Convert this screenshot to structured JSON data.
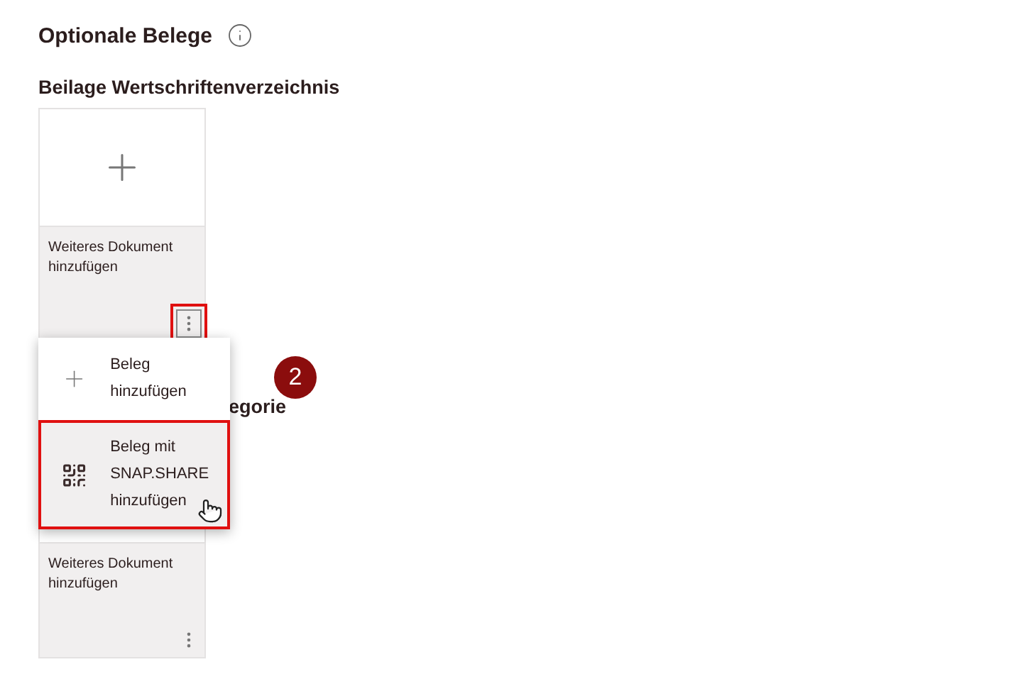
{
  "title": "Optionale Belege",
  "sections": [
    {
      "heading": "Beilage Wertschriftenverzeichnis",
      "heading_covered": false,
      "card": {
        "label": "Weiteres Dokument hinzufügen",
        "menu_button_highlighted": true
      }
    },
    {
      "heading": "egorie",
      "heading_covered": true,
      "card": {
        "label": "Weiteres Dokument hinzufügen",
        "menu_button_highlighted": false
      }
    }
  ],
  "menu": {
    "items": [
      {
        "kind": "add",
        "label": "Beleg hinzufügen",
        "highlighted": false,
        "hovered": false
      },
      {
        "kind": "qr",
        "label": "Beleg mit SNAP.SHARE hinzufügen",
        "highlighted": true,
        "hovered": true
      }
    ]
  },
  "step_badge": "2"
}
